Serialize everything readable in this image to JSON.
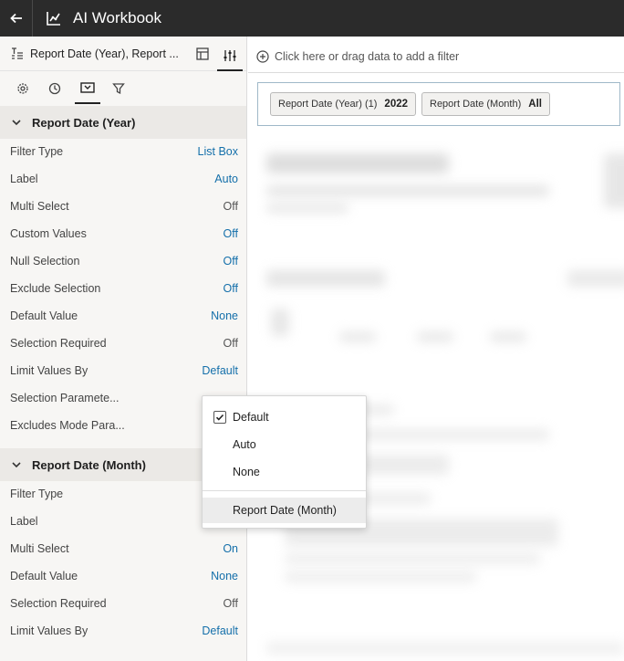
{
  "app": {
    "title": "AI Workbook"
  },
  "panel": {
    "header_title": "Report Date (Year), Report ...",
    "tabs": [
      "settings-icon",
      "clock-icon",
      "filter-display-icon",
      "filter-icon"
    ]
  },
  "section1": {
    "title": "Report Date (Year)",
    "props": [
      {
        "label": "Filter Type",
        "value": "List Box",
        "link": true
      },
      {
        "label": "Label",
        "value": "Auto",
        "link": true
      },
      {
        "label": "Multi Select",
        "value": "Off",
        "link": false
      },
      {
        "label": "Custom Values",
        "value": "Off",
        "link": true
      },
      {
        "label": "Null Selection",
        "value": "Off",
        "link": true
      },
      {
        "label": "Exclude Selection",
        "value": "Off",
        "link": true
      },
      {
        "label": "Default Value",
        "value": "None",
        "link": true
      },
      {
        "label": "Selection Required",
        "value": "Off",
        "link": false
      },
      {
        "label": "Limit Values By",
        "value": "Default",
        "link": true
      },
      {
        "label": "Selection Paramete...",
        "value": "",
        "link": false
      },
      {
        "label": "Excludes Mode Para...",
        "value": "",
        "link": false
      }
    ]
  },
  "section2": {
    "title": "Report Date (Month)",
    "props": [
      {
        "label": "Filter Type",
        "value": "",
        "link": false
      },
      {
        "label": "Label",
        "value": "",
        "link": false
      },
      {
        "label": "Multi Select",
        "value": "On",
        "link": true
      },
      {
        "label": "Default Value",
        "value": "None",
        "link": true
      },
      {
        "label": "Selection Required",
        "value": "Off",
        "link": false
      },
      {
        "label": "Limit Values By",
        "value": "Default",
        "link": true
      }
    ]
  },
  "filter_bar": {
    "placeholder": "Click here or drag data to add a filter"
  },
  "chips": [
    {
      "label": "Report Date (Year) (1)",
      "value": "2022"
    },
    {
      "label": "Report Date (Month)",
      "value": "All"
    }
  ],
  "dropdown": {
    "items": [
      {
        "label": "Default",
        "checked": true
      },
      {
        "label": "Auto",
        "checked": false
      },
      {
        "label": "None",
        "checked": false
      }
    ],
    "extra_item": "Report Date (Month)"
  },
  "colors": {
    "topbar": "#2b2b2b",
    "link": "#146faa",
    "panel_bg": "#f7f6f4"
  }
}
